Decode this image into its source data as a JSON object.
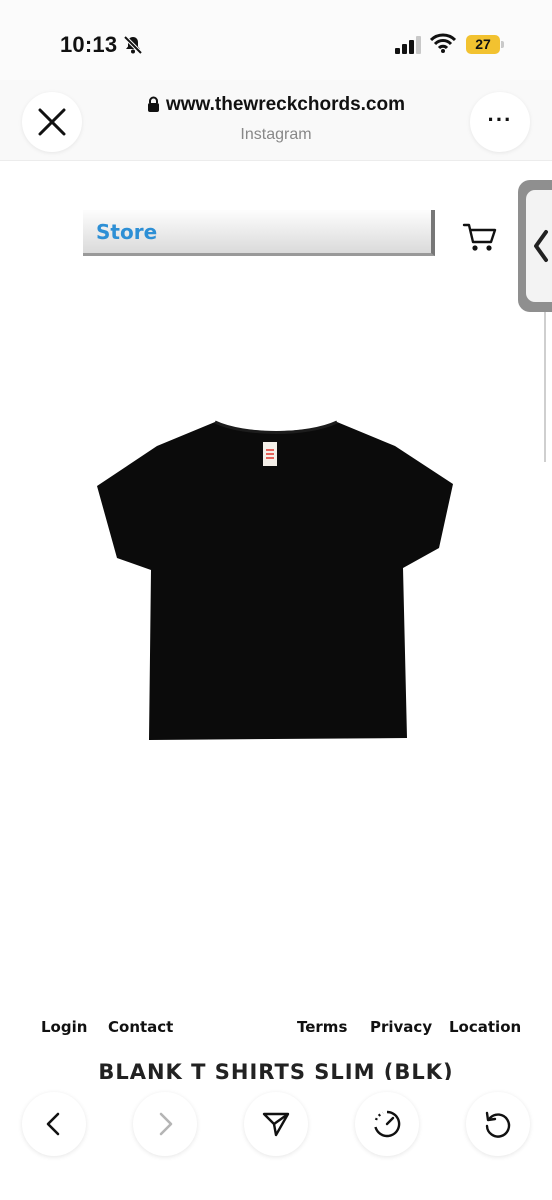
{
  "status_bar": {
    "time": "10:13",
    "battery": "27",
    "icons": [
      "bell-slash-icon",
      "signal-icon",
      "wifi-icon",
      "battery-icon"
    ]
  },
  "browser": {
    "url": "www.thewreckchords.com",
    "source": "Instagram",
    "close_icon": "close-icon",
    "more_label": "···"
  },
  "page": {
    "store_label": "Store",
    "cart_icon": "cart-icon",
    "product_image": "black-tshirt",
    "footer": {
      "login": "Login",
      "contact": "Contact",
      "terms": "Terms",
      "privacy": "Privacy",
      "location": "Location"
    },
    "product_title": "BLANK T SHIRTS SLIM (BLK)"
  },
  "toolbar": {
    "icons": [
      "back-icon",
      "forward-icon",
      "share-icon",
      "timer-icon",
      "reload-icon"
    ]
  },
  "colors": {
    "store_text": "#2d8fd5",
    "battery": "#f2c230",
    "shirt": "#0b0b0b",
    "label": "#e0332b"
  }
}
